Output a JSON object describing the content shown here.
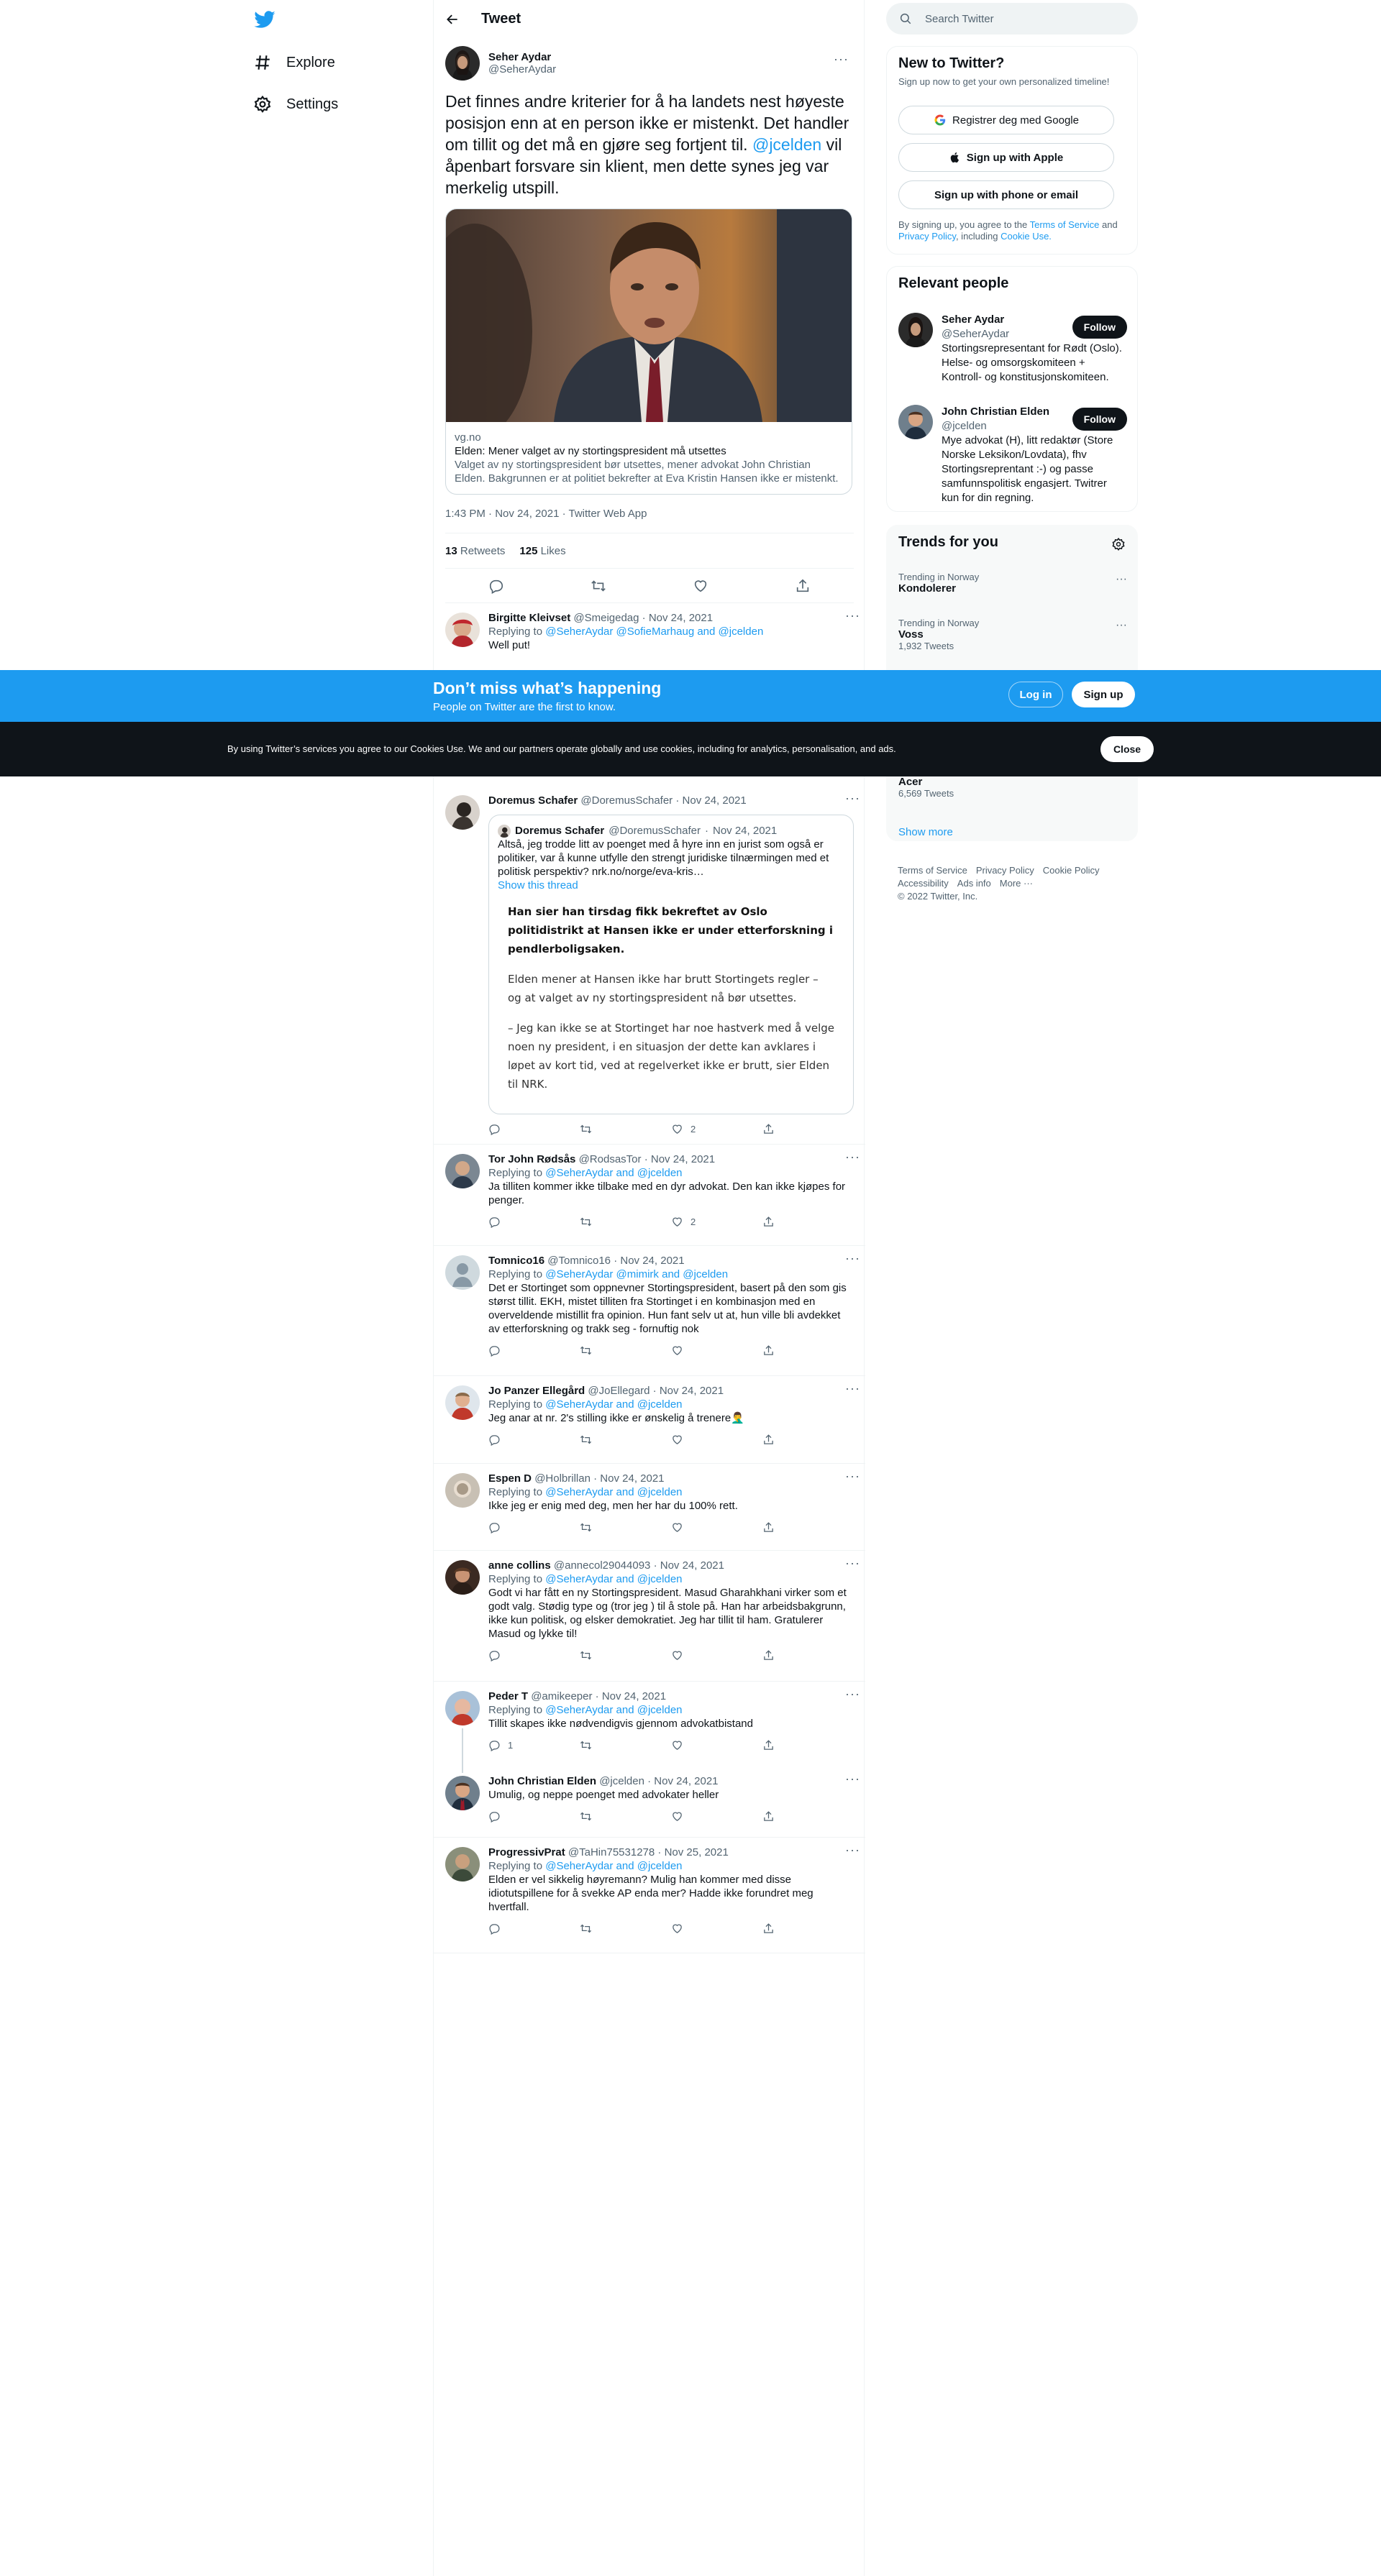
{
  "nav": {
    "explore": "Explore",
    "settings": "Settings"
  },
  "header": {
    "title": "Tweet"
  },
  "focal": {
    "name": "Seher Aydar",
    "handle": "@SeherAydar",
    "text_before": "Det finnes andre kriterier for å ha landets nest høyeste posisjon enn at en person ikke er mistenkt. Det handler om tillit og det må en gjøre seg fortjent til. ",
    "mention": "@jcelden",
    "text_after": " vil åpenbart forsvare sin klient, men dette synes jeg var merkelig utspill.",
    "card": {
      "domain": "vg.no",
      "title": "Elden: Mener valget av ny stortingspresident må utsettes",
      "desc": "Valget av ny stortingspresident bør utsettes, mener advokat John Christian Elden. Bakgrunnen er at politiet bekrefter at Eva Kristin Hansen ikke er mistenkt."
    },
    "meta": "1:43 PM · Nov 24, 2021 · Twitter Web App",
    "retweets_count": "13",
    "retweets_label": "Retweets",
    "likes_count": "125",
    "likes_label": "Likes"
  },
  "replies": [
    {
      "name": "Birgitte Kleivset",
      "handle": "@Smeigedag",
      "date": "Nov 24, 2021",
      "replying_prefix": "Replying to ",
      "replying_to": "@SeherAydar @SofieMarhaug and @jcelden",
      "text": "Well put!"
    },
    {
      "name": "Doremus Schafer",
      "handle": "@DoremusSchafer",
      "date": "Nov 24, 2021",
      "quote": {
        "name": "Doremus Schafer",
        "handle": "@DoremusSchafer",
        "date": "Nov 24, 2021",
        "text": "Altså, jeg trodde litt av poenget med å hyre inn en jurist som også er politiker, var å kunne utfylle den strengt juridiske tilnærmingen med et politisk perspektiv? nrk.no/norge/eva-kris…",
        "show_thread": "Show this thread",
        "article_lead": "Han sier han tirsdag fikk bekreftet av Oslo politidistrikt at Hansen ikke er under etterforskning i pendlerboligsaken.",
        "article_p1": "Elden mener at Hansen ikke har brutt Stortingets regler – og at valget av ny stortingspresident nå bør utsettes.",
        "article_p2": "– Jeg kan ikke se at Stortinget har noe hastverk med å velge noen ny president, i en situasjon der dette kan avklares i løpet av kort tid, ved at regelverket ikke er brutt, sier Elden til NRK."
      },
      "likes": "2"
    },
    {
      "name": "Tor John Rødsås",
      "handle": "@RodsasTor",
      "date": "Nov 24, 2021",
      "replying_prefix": "Replying to ",
      "replying_to": "@SeherAydar and @jcelden",
      "text": "Ja tilliten kommer ikke tilbake med en dyr advokat. Den kan ikke kjøpes for penger.",
      "likes": "2"
    },
    {
      "name": "Tomnico16",
      "handle": "@Tomnico16",
      "date": "Nov 24, 2021",
      "replying_prefix": "Replying to ",
      "replying_to": "@SeherAydar @mimirk and @jcelden",
      "text": "Det er Stortinget som oppnevner Stortingspresident, basert på den som gis størst tillit. EKH, mistet tilliten fra Stortinget i en kombinasjon med en overveldende mistillit fra opinion. Hun fant selv ut at, hun ville bli avdekket av etterforskning og trakk seg - fornuftig nok"
    },
    {
      "name": "Jo Panzer Ellegård",
      "handle": "@JoEllegard",
      "date": "Nov 24, 2021",
      "replying_prefix": "Replying to ",
      "replying_to": "@SeherAydar and @jcelden",
      "text": "Jeg anar at nr. 2's stilling ikke er ønskelig å trenere🤦‍♂️"
    },
    {
      "name": "Espen D",
      "handle": "@Holbrillan",
      "date": "Nov 24, 2021",
      "replying_prefix": "Replying to ",
      "replying_to": "@SeherAydar and @jcelden",
      "text": "Ikke jeg er enig med deg, men her har du 100% rett."
    },
    {
      "name": "anne collins",
      "handle": "@annecol29044093",
      "date": "Nov 24, 2021",
      "replying_prefix": "Replying to ",
      "replying_to": "@SeherAydar and @jcelden",
      "text": "Godt vi har fått en ny Stortingspresident. Masud Gharahkhani virker som et godt valg. Stødig type og (tror jeg ) til å stole på. Han har arbeidsbakgrunn, ikke kun politisk, og elsker demokratiet. Jeg har tillit til ham. Gratulerer Masud og lykke til!"
    },
    {
      "name": "Peder T",
      "handle": "@amikeeper",
      "date": "Nov 24, 2021",
      "replying_prefix": "Replying to ",
      "replying_to": "@SeherAydar and @jcelden",
      "text": "Tillit skapes ikke nødvendigvis gjennom advokatbistand",
      "replies_count": "1"
    },
    {
      "name": "John Christian Elden",
      "handle": "@jcelden",
      "date": "Nov 24, 2021",
      "text": "Umulig, og neppe poenget med advokater heller"
    },
    {
      "name": "ProgressivPrat",
      "handle": "@TaHin75531278",
      "date": "Nov 25, 2021",
      "replying_prefix": "Replying to ",
      "replying_to": "@SeherAydar and @jcelden",
      "text": "Elden er vel sikkelig høyremann? Mulig han kommer med disse idiotutspillene for å svekke AP enda mer? Hadde ikke forundret meg hvertfall."
    }
  ],
  "partial_counts": {
    "left": "1",
    "right": "2"
  },
  "right": {
    "search_placeholder": "Search Twitter",
    "new_title": "New to Twitter?",
    "new_sub": "Sign up now to get your own personalized timeline!",
    "google_btn": "Registrer deg med Google",
    "apple_btn": "Sign up with Apple",
    "phone_btn": "Sign up with phone or email",
    "terms_prefix": "By signing up, you agree to the ",
    "terms_link": "Terms of Service",
    "terms_and": " and ",
    "privacy_link": "Privacy Policy",
    "terms_including": ", including ",
    "cookie_link": "Cookie Use.",
    "relevant_title": "Relevant people",
    "people": [
      {
        "name": "Seher Aydar",
        "handle": "@SeherAydar",
        "bio": "Stortingsrepresentant for Rødt (Oslo). Helse- og omsorgskomiteen + Kontroll- og konstitusjonskomiteen.",
        "follow": "Follow"
      },
      {
        "name": "John Christian Elden",
        "handle": "@jcelden",
        "bio": "Mye advokat (H), litt redaktør (Store Norske Leksikon/Lovdata), fhv Stortingsreprentant :-) og passe samfunnspolitisk engasjert. Twitrer kun for din regning.",
        "follow": "Follow"
      }
    ],
    "trends_title": "Trends for you",
    "trends": [
      {
        "context": "Trending in Norway",
        "name": "Kondolerer",
        "count": ""
      },
      {
        "context": "Trending in Norway",
        "name": "Voss",
        "count": "1,932 Tweets"
      },
      {
        "context": "",
        "name": "Acer",
        "count": "6,569 Tweets"
      }
    ],
    "show_more": "Show more",
    "footer": [
      "Terms of Service",
      "Privacy Policy",
      "Cookie Policy",
      "Accessibility",
      "Ads info",
      "More ···"
    ],
    "copyright": "© 2022 Twitter, Inc."
  },
  "banner": {
    "title": "Don’t miss what’s happening",
    "sub": "People on Twitter are the first to know.",
    "login": "Log in",
    "signup": "Sign up"
  },
  "cookie": {
    "text": "By using Twitter’s services you agree to our Cookies Use. We and our partners operate globally and use cookies, including for analytics, personalisation, and ads.",
    "close": "Close"
  },
  "colors": {
    "accent": "#1d9bf0",
    "text": "#0f1419",
    "muted": "#536471",
    "border": "#eff3f4"
  }
}
